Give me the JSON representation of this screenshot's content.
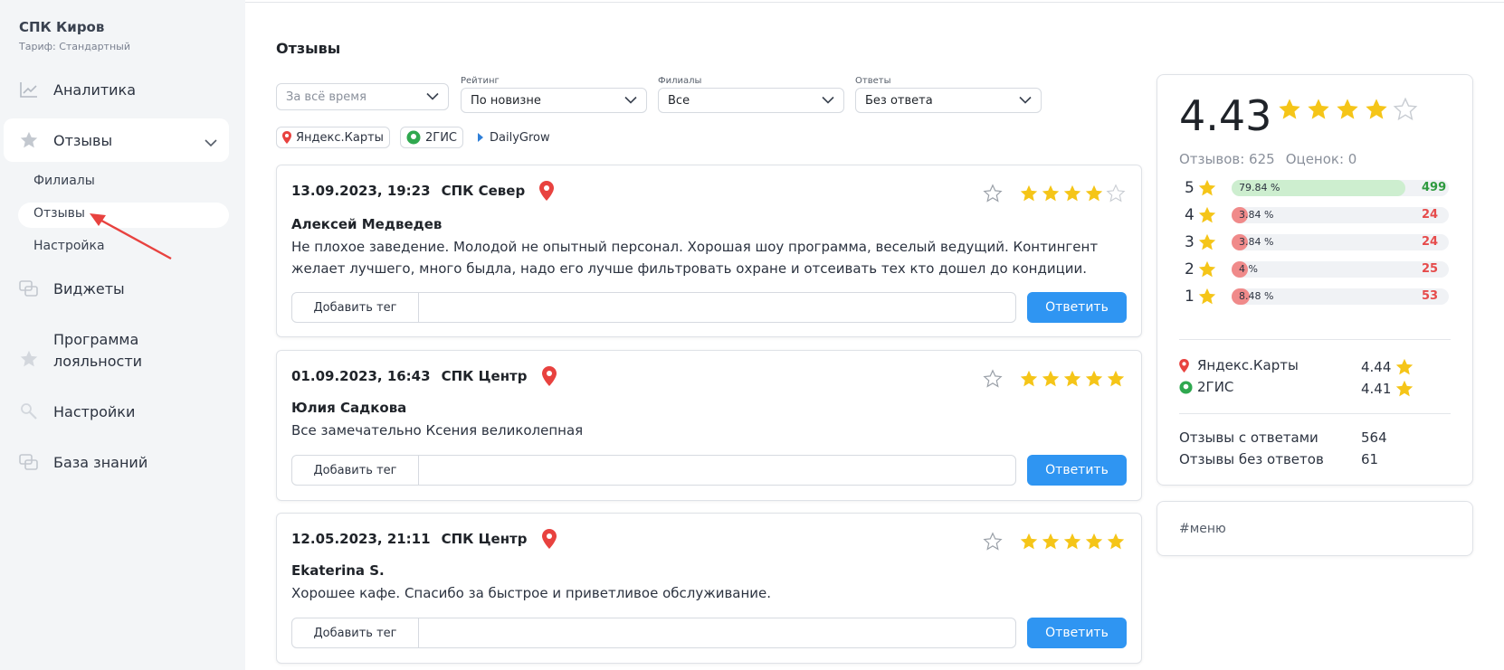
{
  "sidebar": {
    "company": "СПК Киров",
    "plan": "Тариф: Стандартный",
    "nav": [
      {
        "label": "Аналитика",
        "icon": "chart-line-icon"
      },
      {
        "label": "Отзывы",
        "icon": "star-icon"
      },
      {
        "label": "Виджеты",
        "icon": "widgets-icon"
      },
      {
        "label": "Программа",
        "label2": "лояльности",
        "icon": "star-icon"
      },
      {
        "label": "Настройки",
        "icon": "wrench-icon"
      },
      {
        "label": "База знаний",
        "icon": "chat-icon"
      }
    ],
    "subnav": [
      {
        "label": "Филиалы"
      },
      {
        "label": "Отзывы",
        "active": true
      },
      {
        "label": "Настройка"
      }
    ]
  },
  "main": {
    "title": "Отзывы",
    "filters": {
      "period": {
        "label": "",
        "placeholder": "За всё время"
      },
      "rating": {
        "label": "Рейтинг",
        "value": "По новизне"
      },
      "branches": {
        "label": "Филиалы",
        "value": "Все"
      },
      "answers": {
        "label": "Ответы",
        "value": "Без ответа"
      }
    },
    "sources": [
      {
        "label": "Яндекс.Карты",
        "icon": "map-pin-icon"
      },
      {
        "label": "2ГИС",
        "icon": "2gis-icon"
      },
      {
        "label": "DailyGrow",
        "icon": "dailygrow-icon"
      }
    ],
    "reviews": [
      {
        "date": "13.09.2023, 19:23",
        "branch": "СПК Север",
        "rating": 4,
        "author": "Алексей Медведев",
        "text": "Не плохое заведение. Молодой не опытный персонал. Хорошая шоу программа, веселый ведущий. Контингент желает лучшего, много быдла, надо его лучше фильтровать охране и отсеивать тех кто дошел до кондиции.",
        "tag_button": "Добавить тег",
        "reply_button": "Ответить"
      },
      {
        "date": "01.09.2023, 16:43",
        "branch": "СПК Центр",
        "rating": 5,
        "author": "Юлия Садкова",
        "text": "Все замечательно Ксения великолепная",
        "tag_button": "Добавить тег",
        "reply_button": "Ответить"
      },
      {
        "date": "12.05.2023, 21:11",
        "branch": "СПК Центр",
        "rating": 5,
        "author": "Ekaterina S.",
        "text": "Хорошее кафе. Спасибо за быстрое и приветливое обслуживание.",
        "tag_button": "Добавить тег",
        "reply_button": "Ответить"
      }
    ]
  },
  "stats": {
    "rating": "4.43",
    "rating_value": 4.43,
    "reviews_count": "Отзывов: 625",
    "ratings_count": "Оценок: 0",
    "distribution": [
      {
        "stars": "5",
        "percent": "79.84 %",
        "fraction": 0.7984,
        "count": "499",
        "color": "#2e9a3f",
        "fill": "#cdeecf"
      },
      {
        "stars": "4",
        "percent": "3.84 %",
        "fraction": 0.0384,
        "count": "24",
        "color": "#e64b4b",
        "fill": "#f08a8a"
      },
      {
        "stars": "3",
        "percent": "3.84 %",
        "fraction": 0.0384,
        "count": "24",
        "color": "#e64b4b",
        "fill": "#f08a8a"
      },
      {
        "stars": "2",
        "percent": "4 %",
        "fraction": 0.04,
        "count": "25",
        "color": "#e64b4b",
        "fill": "#f08a8a"
      },
      {
        "stars": "1",
        "percent": "8.48 %",
        "fraction": 0.0848,
        "count": "53",
        "color": "#e64b4b",
        "fill": "#f08a8a"
      }
    ],
    "sources": [
      {
        "label": "Яндекс.Карты",
        "value": "4.44",
        "icon": "map-pin-icon"
      },
      {
        "label": "2ГИС",
        "value": "4.41",
        "icon": "2gis-icon"
      }
    ],
    "with_answers_label": "Отзывы с ответами",
    "with_answers": "564",
    "without_answers_label": "Отзывы без ответов",
    "without_answers": "61"
  },
  "tags": {
    "text": "#меню"
  },
  "colors": {
    "accent": "#2f95f2",
    "star": "#f5c518",
    "pin": "#e8423f",
    "gis": "#2fa84f"
  }
}
